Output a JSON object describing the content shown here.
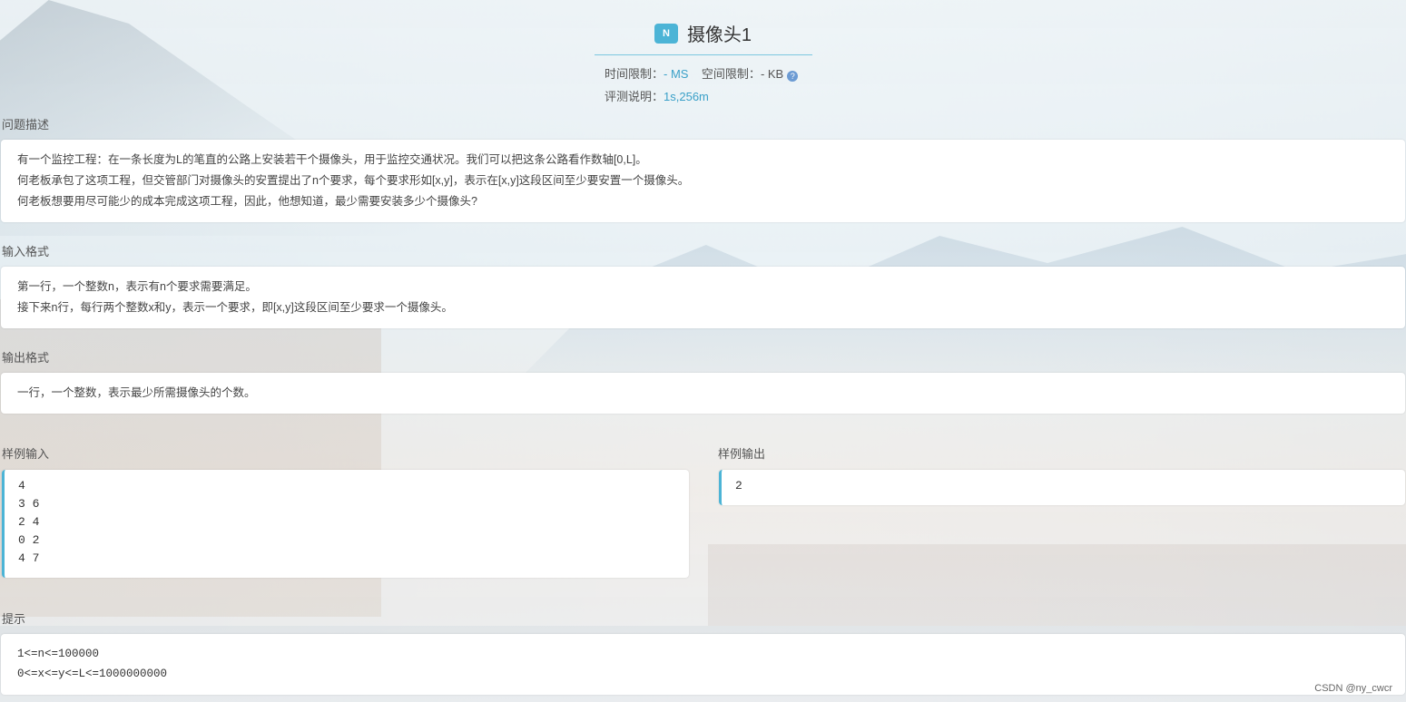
{
  "problem": {
    "badge": "N",
    "title": "摄像头1",
    "time_limit_label": "时间限制：",
    "time_limit_value": "- MS",
    "space_limit_label": "空间限制：",
    "space_limit_value": "- KB",
    "judge_label": "评测说明：",
    "judge_value": "1s,256m"
  },
  "description": {
    "label": "问题描述",
    "lines": [
      "有一个监控工程：在一条长度为L的笔直的公路上安装若干个摄像头，用于监控交通状况。我们可以把这条公路看作数轴[0,L]。",
      "何老板承包了这项工程，但交管部门对摄像头的安置提出了n个要求，每个要求形如[x,y]，表示在[x,y]这段区间至少要安置一个摄像头。",
      "何老板想要用尽可能少的成本完成这项工程，因此，他想知道，最少需要安装多少个摄像头?"
    ]
  },
  "input_format": {
    "label": "输入格式",
    "lines": [
      "第一行，一个整数n，表示有n个要求需要满足。",
      "接下来n行，每行两个整数x和y，表示一个要求，即[x,y]这段区间至少要求一个摄像头。"
    ]
  },
  "output_format": {
    "label": "输出格式",
    "lines": [
      "一行，一个整数，表示最少所需摄像头的个数。"
    ]
  },
  "sample_input": {
    "label": "样例输入",
    "lines": [
      "4",
      "3 6",
      "2 4",
      "0 2",
      "4 7"
    ]
  },
  "sample_output": {
    "label": "样例输出",
    "lines": [
      "2"
    ]
  },
  "hint": {
    "label": "提示",
    "lines": [
      "1<=n<=100000",
      "0<=x<=y<=L<=1000000000"
    ]
  },
  "watermark": "CSDN @ny_cwcr",
  "colors": {
    "accent": "#4cb4d6",
    "background": "#eef3f6"
  },
  "icons": {
    "help": "question-circle-icon"
  }
}
